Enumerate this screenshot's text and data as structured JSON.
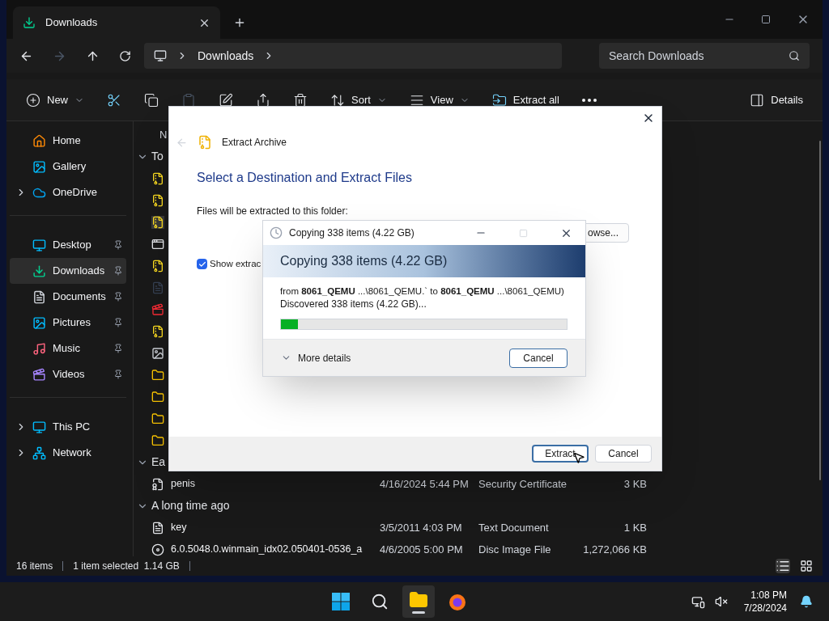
{
  "window": {
    "tab_title": "Downloads",
    "search_placeholder": "Search Downloads",
    "breadcrumb": [
      "Downloads"
    ]
  },
  "toolbar": [
    {
      "kind": "new",
      "label": "New",
      "disabled": false
    },
    {
      "kind": "cut",
      "disabled": false
    },
    {
      "kind": "copy",
      "disabled": false
    },
    {
      "kind": "paste",
      "disabled": true
    },
    {
      "kind": "rename",
      "disabled": false
    },
    {
      "kind": "share",
      "disabled": false
    },
    {
      "kind": "delete",
      "disabled": false
    },
    {
      "kind": "sort",
      "label": "Sort",
      "disabled": false
    },
    {
      "kind": "view",
      "label": "View",
      "disabled": false
    },
    {
      "kind": "extract",
      "label": "Extract all",
      "disabled": false
    },
    {
      "kind": "more",
      "disabled": false
    },
    {
      "kind": "details",
      "label": "Details",
      "disabled": false
    }
  ],
  "sidebar": {
    "sections": [
      {
        "items": [
          {
            "kind": "home",
            "label": "Home",
            "expandable": false,
            "pinned": false,
            "selected": false
          },
          {
            "kind": "gallery",
            "label": "Gallery",
            "expandable": false,
            "pinned": false,
            "selected": false
          },
          {
            "kind": "cloud",
            "label": "OneDrive",
            "expandable": true,
            "pinned": false,
            "selected": false
          }
        ]
      },
      {
        "items": [
          {
            "kind": "desktop",
            "label": "Desktop",
            "expandable": false,
            "pinned": true,
            "selected": false
          },
          {
            "kind": "download",
            "label": "Downloads",
            "expandable": false,
            "pinned": true,
            "selected": true
          },
          {
            "kind": "documents",
            "label": "Documents",
            "expandable": false,
            "pinned": true,
            "selected": false
          },
          {
            "kind": "pictures",
            "label": "Pictures",
            "expandable": false,
            "pinned": true,
            "selected": false
          },
          {
            "kind": "music",
            "label": "Music",
            "expandable": false,
            "pinned": true,
            "selected": false
          },
          {
            "kind": "videos",
            "label": "Videos",
            "expandable": false,
            "pinned": true,
            "selected": false
          }
        ]
      },
      {
        "items": [
          {
            "kind": "pc",
            "label": "This PC",
            "expandable": true,
            "pinned": false,
            "selected": false
          },
          {
            "kind": "network",
            "label": "Network",
            "expandable": true,
            "pinned": false,
            "selected": false
          }
        ]
      }
    ]
  },
  "file_list": {
    "column_1": "N",
    "groups": [
      {
        "label": "To",
        "expanded": true,
        "items": [
          {
            "kind": "zip"
          },
          {
            "kind": "zip"
          },
          {
            "kind": "zip",
            "selected": true
          },
          {
            "kind": "exe"
          },
          {
            "kind": "zip"
          },
          {
            "kind": "dark"
          },
          {
            "kind": "media"
          },
          {
            "kind": "zip"
          },
          {
            "kind": "image"
          },
          {
            "kind": "folder"
          },
          {
            "kind": "folder"
          },
          {
            "kind": "folder"
          },
          {
            "kind": "folder"
          }
        ]
      },
      {
        "label": "Ea",
        "expanded": true,
        "items": [
          {
            "kind": "certificate",
            "name": "penis",
            "date": "4/16/2024 5:44 PM",
            "type": "Security Certificate",
            "size": "3 KB"
          }
        ]
      },
      {
        "label": "A long time ago",
        "expanded": true,
        "items": [
          {
            "kind": "text",
            "name": "key",
            "date": "3/5/2011 4:03 PM",
            "type": "Text Document",
            "size": "1 KB"
          },
          {
            "kind": "disc",
            "name": "6.0.5048.0.winmain_idx02.050401-0536_a",
            "date": "4/6/2005 5:00 PM",
            "type": "Disc Image File",
            "size": "1,272,066 KB"
          }
        ]
      }
    ]
  },
  "status_bar": {
    "count": "16 items",
    "selection": "1 item selected  1.14 GB"
  },
  "extract_dialog": {
    "title": "Extract Archive",
    "heading": "Select a Destination and Extract Files",
    "folder_label": "Files will be extracted to this folder:",
    "browse_label": "owse...",
    "checkbox": {
      "label": "Show extrac",
      "checked": true
    },
    "buttons": [
      {
        "label": "Extract",
        "focused": true
      },
      {
        "label": "Cancel",
        "focused": false
      }
    ]
  },
  "copy_dialog": {
    "title": "Copying 338 items (4.22 GB)",
    "heading": "Copying 338 items (4.22 GB)",
    "from_line": "from **8061_QEMU** ...\\8061_QEMU.` to **8061_QEMU** ...\\8061_QEMU)",
    "status": "Discovered 338 items (4.22 GB)...",
    "level": 0.06,
    "more_details": "More details",
    "cancel": "Cancel"
  },
  "taskbar": {
    "apps": [
      {
        "kind": "start",
        "active": false
      },
      {
        "kind": "search",
        "active": false
      },
      {
        "kind": "explorer",
        "active": true
      },
      {
        "kind": "browser",
        "active": false
      }
    ],
    "time": "1:08 PM",
    "date": "7/28/2024"
  }
}
